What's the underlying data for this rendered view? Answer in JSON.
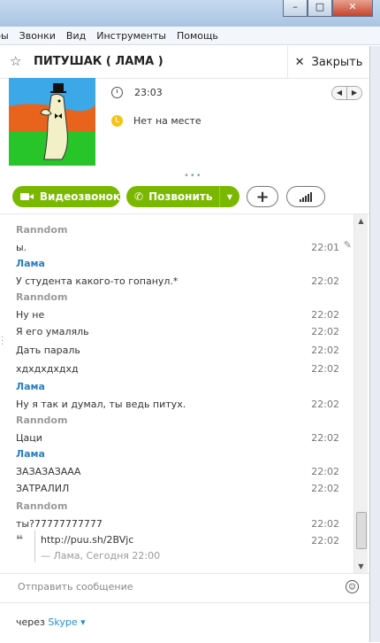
{
  "window": {
    "minimize": "–",
    "maximize": "□",
    "close": "✕"
  },
  "menu": [
    "ры",
    "Звонки",
    "Вид",
    "Инструменты",
    "Помощь"
  ],
  "contact": {
    "name": "ПИТУШАК ( ЛАМА )",
    "close_label": "Закрыть",
    "local_time": "23:03",
    "status": "Нет на месте"
  },
  "actions": {
    "video_label": "Видеозвонок",
    "call_label": "Позвонить"
  },
  "messages": [
    {
      "type": "sender",
      "who": "r",
      "text": "Ranndom"
    },
    {
      "type": "msg",
      "text": "ы.",
      "time": "22:01",
      "pencil": true
    },
    {
      "type": "sender",
      "who": "l",
      "text": "Лама"
    },
    {
      "type": "msg",
      "text": "У студента какого-то гопанул.*",
      "time": "22:02"
    },
    {
      "type": "sender",
      "who": "r",
      "text": "Ranndom"
    },
    {
      "type": "msg",
      "text": "Ну не",
      "time": "22:02"
    },
    {
      "type": "msg",
      "text": "Я его умаляль",
      "time": "22:02",
      "gap": true
    },
    {
      "type": "msg",
      "text": "Дать параль",
      "time": "22:02",
      "gap": true
    },
    {
      "type": "msg",
      "text": "хдхдхдхдхд",
      "time": "22:02",
      "gap": true
    },
    {
      "type": "sender",
      "who": "l",
      "text": "Лама"
    },
    {
      "type": "msg",
      "text": "Ну я так и думал, ты ведь питух.",
      "time": "22:02"
    },
    {
      "type": "sender",
      "who": "r",
      "text": "Ranndom"
    },
    {
      "type": "msg",
      "text": "Цаци",
      "time": "22:02"
    },
    {
      "type": "sender",
      "who": "l",
      "text": "Лама"
    },
    {
      "type": "msg",
      "text": "ЗАЗАЗАЗААА",
      "time": "22:02"
    },
    {
      "type": "msg",
      "text": "ЗАТРАЛИЛ",
      "time": "22:02",
      "gap": true
    },
    {
      "type": "sender",
      "who": "r",
      "text": "Ranndom"
    },
    {
      "type": "msg",
      "text": "ты?77777777777",
      "time": "22:02"
    },
    {
      "type": "quote",
      "link": "http://puu.sh/2BVjc",
      "source": "— Лама, Сегодня 22:00",
      "time": "22:02"
    }
  ],
  "input": {
    "placeholder": "Отправить сообщение"
  },
  "footer": {
    "via": "через",
    "service": "Skype"
  }
}
